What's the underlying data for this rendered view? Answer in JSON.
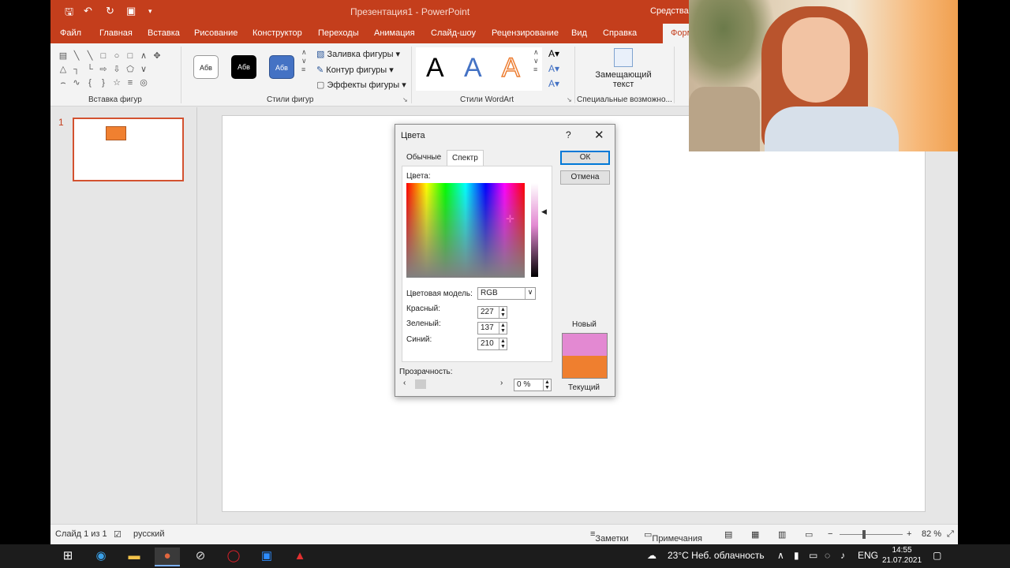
{
  "app": {
    "title": "Презентация1 - PowerPoint",
    "tools_tab": "Средства р",
    "qa_icons": [
      "save-icon",
      "undo-icon",
      "redo-icon",
      "start-from-beginning-icon",
      "customize-qat-icon"
    ]
  },
  "tabs": [
    "Файл",
    "Главная",
    "Вставка",
    "Рисование",
    "Конструктор",
    "Переходы",
    "Анимация",
    "Слайд-шоу",
    "Рецензирование",
    "Вид",
    "Справка",
    "Формат"
  ],
  "ribbon": {
    "insert_shapes_label": "Вставка фигур",
    "shape_styles_label": "Стили фигур",
    "style_sample_text": "Абв",
    "shape_fill": "Заливка фигуры",
    "shape_outline": "Контур фигуры",
    "shape_effects": "Эффекты фигуры",
    "wordart_label": "Стили WordArt",
    "wordart_letter": "A",
    "alt_text_label": "Замещающий текст",
    "accessibility_label": "Специальные возможно..."
  },
  "slides_panel": {
    "slide_number": "1"
  },
  "status": {
    "slide_info": "Слайд 1 из 1",
    "language": "русский",
    "notes": "Заметки",
    "comments": "Примечания",
    "zoom": "82 %"
  },
  "dialog": {
    "title": "Цвета",
    "help": "?",
    "tabs": {
      "standard": "Обычные",
      "custom": "Спектр"
    },
    "colors_label": "Цвета:",
    "color_model_label": "Цветовая модель:",
    "color_model_value": "RGB",
    "red_label": "Красный:",
    "red_value": "227",
    "green_label": "Зеленый:",
    "green_value": "137",
    "blue_label": "Синий:",
    "blue_value": "210",
    "transparency_label": "Прозрачность:",
    "transparency_value": "0 %",
    "ok": "ОК",
    "cancel": "Отмена",
    "new_label": "Новый",
    "current_label": "Текущий",
    "new_color": "#e389d2",
    "current_color": "#ef7f2f"
  },
  "taskbar": {
    "weather": "23°C  Неб. облачность",
    "language": "ENG",
    "time": "14:55",
    "date": "21.07.2021"
  }
}
